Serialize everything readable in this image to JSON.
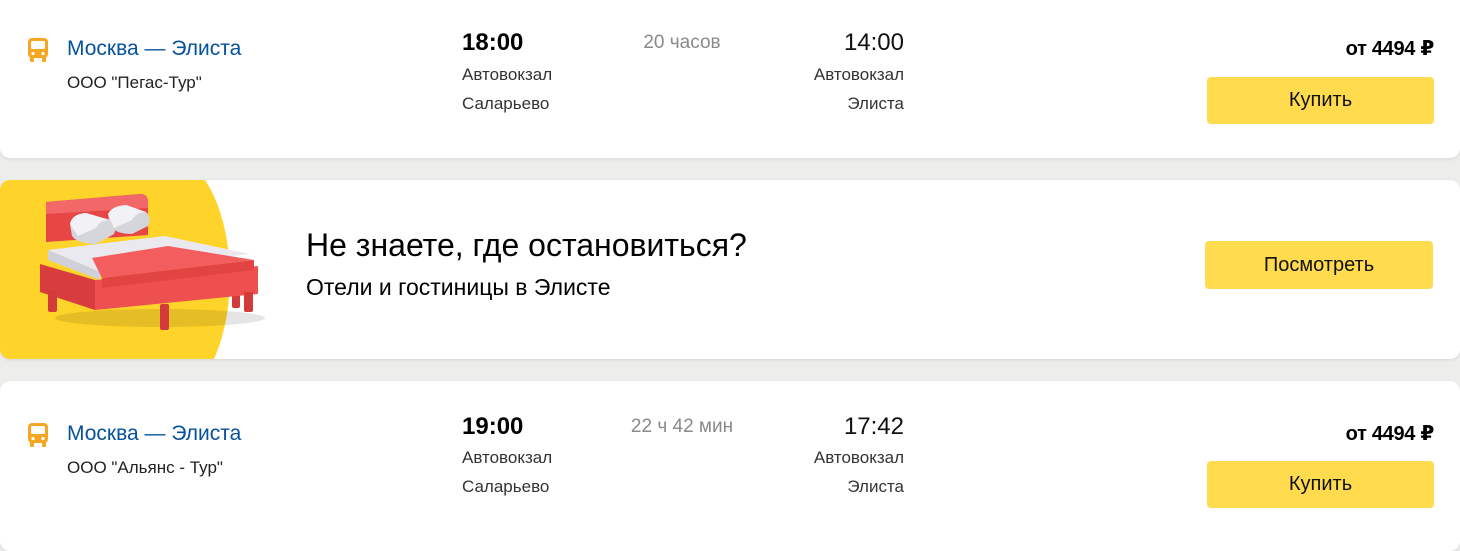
{
  "colors": {
    "accent_yellow": "#ffdb4d",
    "bus_icon": "#f5a623",
    "link_blue": "#04519c",
    "promo_bed_red": "#ef4a4a"
  },
  "trips": [
    {
      "route": "Москва — Элиста",
      "carrier": "ООО \"Пегас-Тур\"",
      "departure_time": "18:00",
      "departure_station_line1": "Автовокзал",
      "departure_station_line2": "Саларьево",
      "duration": "20 часов",
      "arrival_time": "14:00",
      "arrival_station_line1": "Автовокзал",
      "arrival_station_line2": "Элиста",
      "price": "от 4494 ₽",
      "buy_label": "Купить",
      "icon": "bus-icon"
    },
    {
      "route": "Москва — Элиста",
      "carrier": "ООО \"Альянс - Тур\"",
      "departure_time": "19:00",
      "departure_station_line1": "Автовокзал",
      "departure_station_line2": "Саларьево",
      "duration": "22 ч 42 мин",
      "arrival_time": "17:42",
      "arrival_station_line1": "Автовокзал",
      "arrival_station_line2": "Элиста",
      "price": "от 4494 ₽",
      "buy_label": "Купить",
      "icon": "bus-icon"
    }
  ],
  "promo": {
    "title": "Не знаете, где остановиться?",
    "subtitle": "Отели и гостиницы в Элисте",
    "button_label": "Посмотреть",
    "icon": "bed-icon"
  }
}
